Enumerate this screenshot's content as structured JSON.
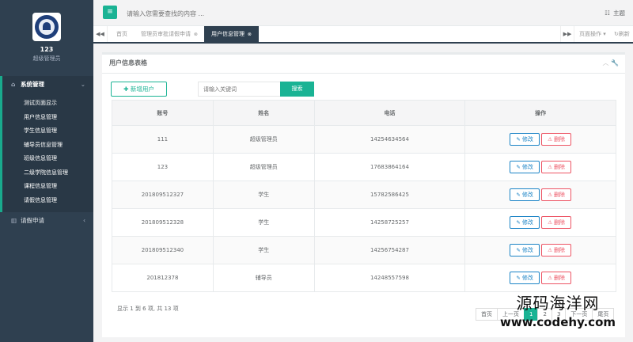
{
  "sidebar": {
    "username": "123",
    "role": "超级管理员",
    "groups": [
      {
        "label": "系统管理",
        "icon": "home-icon",
        "expanded": true,
        "items": [
          "测试页面显示",
          "用户信息管理",
          "学生信息管理",
          "辅导员信息管理",
          "班级信息管理",
          "二级学院信息管理",
          "课程信息管理",
          "请假信息管理"
        ]
      },
      {
        "label": "请假申请",
        "icon": "bar-chart-icon",
        "expanded": false,
        "items": []
      }
    ]
  },
  "topbar": {
    "search_placeholder": "请输入您需要查找的内容 ...",
    "theme_label": "主题"
  },
  "tabs": {
    "items": [
      {
        "label": "首页",
        "closable": false,
        "active": false
      },
      {
        "label": "管理员审批请假申请",
        "closable": true,
        "active": false
      },
      {
        "label": "用户信息管理",
        "closable": true,
        "active": true
      }
    ],
    "page_ops": "页面操作",
    "refresh": "刷新"
  },
  "panel": {
    "title": "用户信息表格",
    "add_label": "新增用户",
    "keyword_placeholder": "请输入关键词",
    "search_label": "搜索",
    "columns": [
      "账号",
      "姓名",
      "电话",
      "操作"
    ],
    "rows": [
      {
        "account": "111",
        "name": "超级管理员",
        "phone": "14254634564"
      },
      {
        "account": "123",
        "name": "超级管理员",
        "phone": "17683864164"
      },
      {
        "account": "201809512327",
        "name": "学生",
        "phone": "15782586425"
      },
      {
        "account": "201809512328",
        "name": "学生",
        "phone": "14258725257"
      },
      {
        "account": "201809512340",
        "name": "学生",
        "phone": "14256754287"
      },
      {
        "account": "201812378",
        "name": "辅导员",
        "phone": "14248557598"
      }
    ],
    "edit_label": "修改",
    "delete_label": "删除",
    "paging_info": "显示 1 到 6 项, 共 13 项",
    "pager": [
      "首页",
      "上一页",
      "1",
      "2",
      "3",
      "下一页",
      "尾页"
    ]
  },
  "watermark": {
    "line1": "源码海洋网",
    "line2": "www.codehy.com"
  },
  "colors": {
    "sidebar": "#2f4050",
    "accent": "#1ab394",
    "edit": "#1c84c6",
    "delete": "#ed5565"
  }
}
